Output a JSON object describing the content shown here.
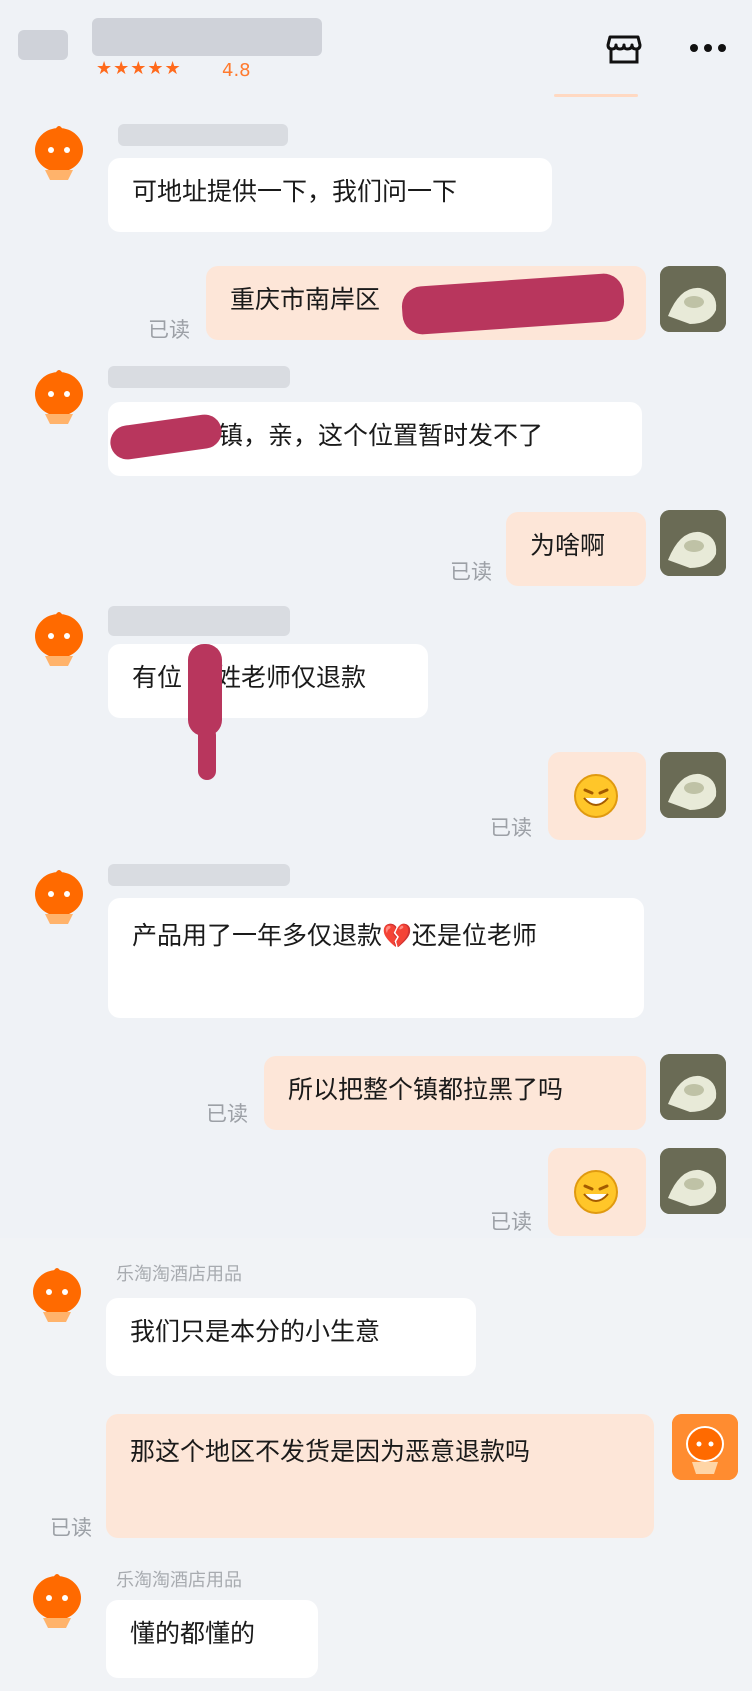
{
  "header": {
    "stars": "★★★★★",
    "rating": "4.8",
    "shop_icon": "store-icon",
    "more_icon": "more-horizontal-icon"
  },
  "messages": [
    {
      "side": "left",
      "text": "可地址提供一下，我们问一下"
    },
    {
      "side": "right",
      "text": "重庆市南岸区",
      "status": "已读"
    },
    {
      "side": "left",
      "text": "镇，亲，这个位置暂时发不了"
    },
    {
      "side": "right",
      "text": "为啥啊",
      "status": "已读"
    },
    {
      "side": "left",
      "text_a": "有位",
      "text_b": "姓老师仅退款"
    },
    {
      "side": "right",
      "emoji": "face-emoji",
      "status": "已读"
    },
    {
      "side": "left",
      "text_a": "产品用了一年多仅退款",
      "text_b": "还是位老师",
      "emoji": "broken-heart-emoji"
    },
    {
      "side": "right",
      "text": "所以把整个镇都拉黑了吗",
      "status": "已读"
    },
    {
      "side": "right",
      "emoji": "face-emoji",
      "status": "已读"
    },
    {
      "side": "left",
      "sender": "乐淘淘酒店用品",
      "text": "我们只是本分的小生意"
    },
    {
      "side": "right",
      "text": "那这个地区不发货是因为恶意退款吗",
      "status": "已读"
    },
    {
      "side": "left",
      "sender": "乐淘淘酒店用品",
      "text": "懂的都懂的"
    }
  ],
  "colors": {
    "accent": "#ff6a1c",
    "bubble_right": "#fde6d8",
    "bubble_left": "#ffffff",
    "read_status": "#9ca0a6",
    "redaction": "#b8365d"
  }
}
